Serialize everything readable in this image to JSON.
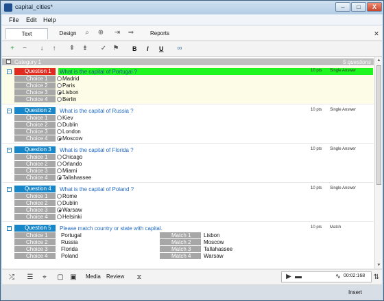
{
  "app": {
    "title": "capital_cities*",
    "window_controls": [
      "–",
      "□",
      "X"
    ]
  },
  "menu": [
    "File",
    "Edit",
    "Help"
  ],
  "main_toolbar": {
    "modes": [
      "Text",
      "Design"
    ],
    "reports_label": "Reports",
    "close_glyph": "✕"
  },
  "format_toolbar": {
    "bold": "B",
    "italic": "I",
    "underline": "U"
  },
  "category": {
    "title": "Category 1",
    "count": "5 questions"
  },
  "questions": [
    {
      "label": "Question 1",
      "text": "What is the capital of Portugal ?",
      "points": "10 pts",
      "type": "Single Answer",
      "color": "#e22b1f",
      "highlight": "#1ff520",
      "choices": [
        {
          "label": "Choice 1",
          "text": "Madrid",
          "selected": false
        },
        {
          "label": "Choice 2",
          "text": "Paris",
          "selected": false
        },
        {
          "label": "Choice 3",
          "text": "Lisbon",
          "selected": true
        },
        {
          "label": "Choice 4",
          "text": "Berlin",
          "selected": false
        }
      ]
    },
    {
      "label": "Question 2",
      "text": "What is the capital of Russia ?",
      "points": "10 pts",
      "type": "Single Answer",
      "color": "#1787c9",
      "choices": [
        {
          "label": "Choice 1",
          "text": "Kiev",
          "selected": false
        },
        {
          "label": "Choice 2",
          "text": "Dublin",
          "selected": false
        },
        {
          "label": "Choice 3",
          "text": "London",
          "selected": false
        },
        {
          "label": "Choice 4",
          "text": "Moscow",
          "selected": true
        }
      ]
    },
    {
      "label": "Question 3",
      "text": "What is the capital  of Florida ?",
      "points": "10 pts",
      "type": "Single Answer",
      "color": "#1787c9",
      "choices": [
        {
          "label": "Choice 1",
          "text": "Chicago",
          "selected": false
        },
        {
          "label": "Choice 2",
          "text": "Orlando",
          "selected": false
        },
        {
          "label": "Choice 3",
          "text": "Miami",
          "selected": false
        },
        {
          "label": "Choice 4",
          "text": "Tallahassee",
          "selected": true
        }
      ]
    },
    {
      "label": "Question 4",
      "text": "What is the capital of Poland ?",
      "points": "10 pts",
      "type": "Single Answer",
      "color": "#1787c9",
      "choices": [
        {
          "label": "Choice 1",
          "text": "Rome",
          "selected": false
        },
        {
          "label": "Choice 2",
          "text": "Dublin",
          "selected": false
        },
        {
          "label": "Choice 3",
          "text": "Warsaw",
          "selected": true
        },
        {
          "label": "Choice 4",
          "text": "Helsinki",
          "selected": false
        }
      ]
    },
    {
      "label": "Question 5",
      "text": "Please match country or state with capital.",
      "points": "10 pts",
      "type": "Match",
      "color": "#1787c9",
      "pairs": [
        {
          "choice_label": "Choice 1",
          "choice": "Portugal",
          "match_label": "Match 1",
          "match": "Lisbon"
        },
        {
          "choice_label": "Choice 2",
          "choice": "Russia",
          "match_label": "Match 2",
          "match": "Moscow"
        },
        {
          "choice_label": "Choice 3",
          "choice": "Florida",
          "match_label": "Match 3",
          "match": "Tallahassee"
        },
        {
          "choice_label": "Choice 4",
          "choice": "Poland",
          "match_label": "Match 4",
          "match": "Warsaw"
        }
      ]
    }
  ],
  "bottom_toolbar": {
    "media_label": "Media",
    "review_label": "Review",
    "time": "00:02:168"
  },
  "footer": {
    "insert_label": "Insert"
  }
}
